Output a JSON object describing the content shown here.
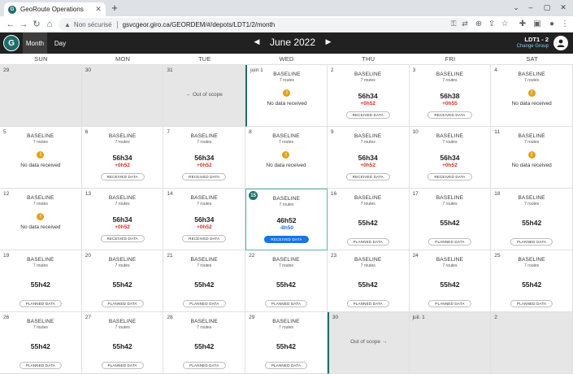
{
  "browser": {
    "tab_title": "GeoRoute Operations",
    "favicon_letter": "G",
    "insecure_label": "Non sécurisé",
    "url": "gsvcgeor.giro.ca/GEORDEM/#/depots/LDT1/2/month"
  },
  "header": {
    "logo_letter": "G",
    "view_month": "Month",
    "view_day": "Day",
    "month_title": "June 2022",
    "group_name": "LDT1 - 2",
    "change_group": "Change Group"
  },
  "weekdays": [
    "SUN",
    "MON",
    "TUE",
    "WED",
    "THU",
    "FRI",
    "SAT"
  ],
  "labels": {
    "baseline": "BASELINE",
    "routes": "7 routes",
    "no_data": "No data received",
    "received": "RECEIVED DATA",
    "planned": "PLANNED DATA",
    "out_of_scope": "Out of scope"
  },
  "days": [
    {
      "label": "29",
      "state": "gray"
    },
    {
      "label": "30",
      "state": "gray"
    },
    {
      "label": "31",
      "state": "oos-left"
    },
    {
      "label": "juin 1",
      "state": "nodata",
      "first_day": true
    },
    {
      "label": "2",
      "state": "received",
      "value": "56h34",
      "diff": "+0h52"
    },
    {
      "label": "3",
      "state": "received",
      "value": "56h38",
      "diff": "+0h55"
    },
    {
      "label": "4",
      "state": "nodata"
    },
    {
      "label": "5",
      "state": "nodata"
    },
    {
      "label": "6",
      "state": "received",
      "value": "56h34",
      "diff": "+0h52"
    },
    {
      "label": "7",
      "state": "received",
      "value": "56h34",
      "diff": "+0h52"
    },
    {
      "label": "8",
      "state": "nodata"
    },
    {
      "label": "9",
      "state": "received",
      "value": "56h34",
      "diff": "+0h52"
    },
    {
      "label": "10",
      "state": "received",
      "value": "56h34",
      "diff": "+0h52"
    },
    {
      "label": "11",
      "state": "nodata"
    },
    {
      "label": "12",
      "state": "nodata"
    },
    {
      "label": "13",
      "state": "received",
      "value": "56h34",
      "diff": "+0h52"
    },
    {
      "label": "14",
      "state": "received",
      "value": "56h34",
      "diff": "+0h52"
    },
    {
      "label": "15",
      "state": "received",
      "value": "46h52",
      "diff": "-8h50",
      "today": true
    },
    {
      "label": "16",
      "state": "planned",
      "value": "55h42"
    },
    {
      "label": "17",
      "state": "planned",
      "value": "55h42"
    },
    {
      "label": "18",
      "state": "planned",
      "value": "55h42"
    },
    {
      "label": "19",
      "state": "planned",
      "value": "55h42"
    },
    {
      "label": "20",
      "state": "planned",
      "value": "55h42"
    },
    {
      "label": "21",
      "state": "planned",
      "value": "55h42"
    },
    {
      "label": "22",
      "state": "planned",
      "value": "55h42"
    },
    {
      "label": "23",
      "state": "planned",
      "value": "55h42"
    },
    {
      "label": "24",
      "state": "planned",
      "value": "55h42"
    },
    {
      "label": "25",
      "state": "planned",
      "value": "55h42"
    },
    {
      "label": "26",
      "state": "planned",
      "value": "55h42"
    },
    {
      "label": "27",
      "state": "planned",
      "value": "55h42"
    },
    {
      "label": "28",
      "state": "planned",
      "value": "55h42"
    },
    {
      "label": "29",
      "state": "planned",
      "value": "55h42"
    },
    {
      "label": "30",
      "state": "oos-right",
      "after_last": true
    },
    {
      "label": "juil. 1",
      "state": "gray"
    },
    {
      "label": "2",
      "state": "gray"
    }
  ]
}
